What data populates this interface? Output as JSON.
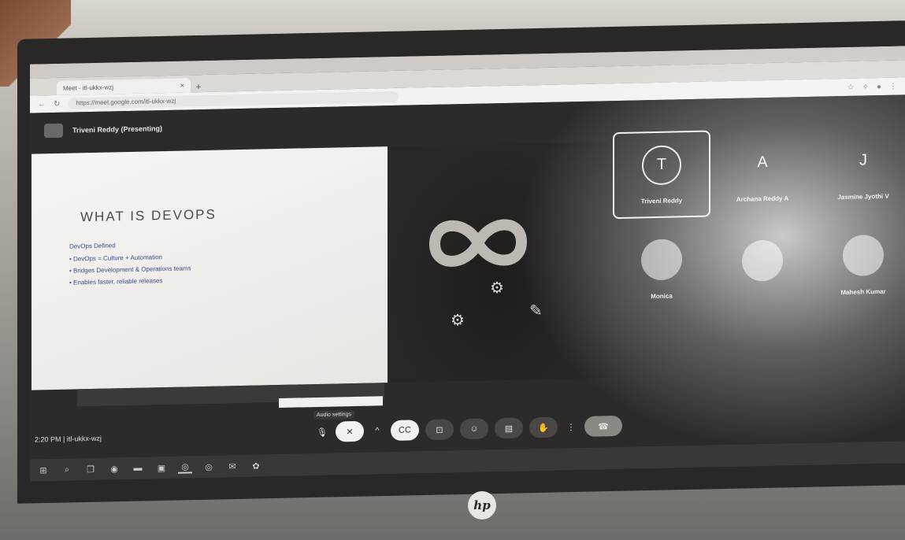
{
  "browser": {
    "window_title": "",
    "tab_title": "Meet - itl-ukkx-wzj",
    "tab_close": "×",
    "new_tab": "+",
    "url": "https://meet.google.com/itl-ukkx-wzj",
    "icons": [
      "back-icon",
      "reload-icon",
      "lock-icon",
      "star-icon",
      "extensions-icon",
      "profile-icon"
    ]
  },
  "meet": {
    "pin_label": "",
    "presenter": "Triveni Reddy (Presenting)",
    "slide": {
      "title": "WHAT IS DEVOPS",
      "subtitle": "DevOps Defined",
      "bullets": [
        "DevOps = Culture + Automation",
        "Bridges Development & Operations teams",
        "Enables faster, reliable releases"
      ]
    },
    "participants": [
      {
        "initial": "T",
        "name": "Triveni Reddy",
        "active": true
      },
      {
        "initial": "A",
        "name": "Archana Reddy A",
        "active": false
      },
      {
        "initial": "J",
        "name": "Jasmine Jyothi V",
        "active": false
      },
      {
        "initial": "",
        "name": "Monica",
        "active": false
      },
      {
        "initial": "",
        "name": "",
        "active": false
      },
      {
        "initial": "",
        "name": "Mahesh Kumar",
        "active": false
      }
    ],
    "clock": "2:20 PM  |  itl-ukkx-wzj",
    "audio_settings_label": "Audio settings",
    "controls": [
      {
        "name": "mic-icon",
        "glyph": "🎙"
      },
      {
        "name": "camera-off-icon",
        "glyph": "✕"
      },
      {
        "name": "chevron-up-icon",
        "glyph": "^"
      },
      {
        "name": "captions-icon",
        "glyph": "CC"
      },
      {
        "name": "present-icon",
        "glyph": "⊡"
      },
      {
        "name": "emoji-icon",
        "glyph": "☺"
      },
      {
        "name": "chat-icon",
        "glyph": "▤"
      },
      {
        "name": "hand-icon",
        "glyph": "✋"
      },
      {
        "name": "more-icon",
        "glyph": "⋮"
      },
      {
        "name": "end-call-icon",
        "glyph": "☎"
      }
    ]
  },
  "taskbar": {
    "icons": [
      {
        "name": "start-icon",
        "glyph": "⊞"
      },
      {
        "name": "search-icon",
        "glyph": "⌕"
      },
      {
        "name": "task-view-icon",
        "glyph": "❐"
      },
      {
        "name": "widget-icon",
        "glyph": "◉"
      },
      {
        "name": "explorer-icon",
        "glyph": "▬"
      },
      {
        "name": "store-icon",
        "glyph": "▣"
      },
      {
        "name": "chrome-icon",
        "glyph": "◎"
      },
      {
        "name": "chrome-alt-icon",
        "glyph": "◎"
      },
      {
        "name": "mail-icon",
        "glyph": "✉"
      },
      {
        "name": "app-icon",
        "glyph": "✿"
      }
    ]
  },
  "device": {
    "logo": "hp"
  },
  "colors": {
    "screen_bg": "#2d2b2a",
    "slide_text": "#3a4a8a",
    "bezel": "#2a2827"
  }
}
